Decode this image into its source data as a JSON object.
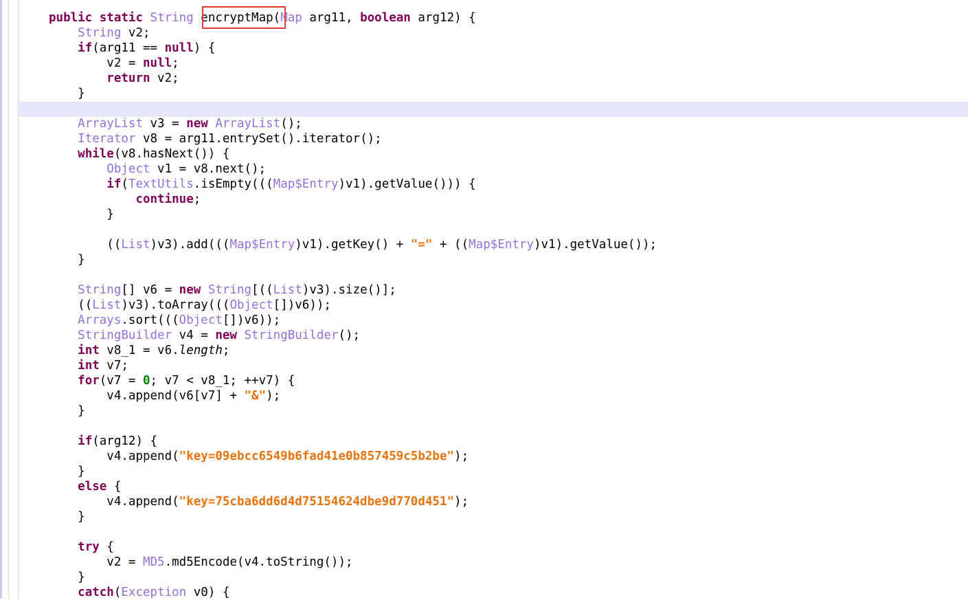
{
  "editor": {
    "lines": [
      {
        "indent": 0,
        "tokens": [
          [
            "kw",
            "public"
          ],
          [
            "p",
            " "
          ],
          [
            "kw",
            "static"
          ],
          [
            "p",
            " "
          ],
          [
            "ty",
            "String"
          ],
          [
            "p",
            " encryptMap("
          ],
          [
            "ty",
            "Map"
          ],
          [
            "p",
            " arg11, "
          ],
          [
            "kw",
            "boolean"
          ],
          [
            "p",
            " arg12) {"
          ]
        ]
      },
      {
        "indent": 1,
        "tokens": [
          [
            "ty",
            "String"
          ],
          [
            "p",
            " v2;"
          ]
        ]
      },
      {
        "indent": 1,
        "tokens": [
          [
            "kw",
            "if"
          ],
          [
            "p",
            "(arg11 == "
          ],
          [
            "kw",
            "null"
          ],
          [
            "p",
            ") {"
          ]
        ]
      },
      {
        "indent": 2,
        "tokens": [
          [
            "p",
            "v2 = "
          ],
          [
            "kw",
            "null"
          ],
          [
            "p",
            ";"
          ]
        ]
      },
      {
        "indent": 2,
        "tokens": [
          [
            "kw",
            "return"
          ],
          [
            "p",
            " v2;"
          ]
        ]
      },
      {
        "indent": 1,
        "tokens": [
          [
            "p",
            "}"
          ]
        ]
      },
      {
        "indent": 0,
        "tokens": []
      },
      {
        "indent": 1,
        "tokens": [
          [
            "ty",
            "ArrayList"
          ],
          [
            "p",
            " v3 = "
          ],
          [
            "kw",
            "new"
          ],
          [
            "p",
            " "
          ],
          [
            "ty",
            "ArrayList"
          ],
          [
            "p",
            "();"
          ]
        ]
      },
      {
        "indent": 1,
        "tokens": [
          [
            "ty",
            "Iterator"
          ],
          [
            "p",
            " v8 = arg11.entrySet().iterator();"
          ]
        ]
      },
      {
        "indent": 1,
        "tokens": [
          [
            "kw",
            "while"
          ],
          [
            "p",
            "(v8.hasNext()) {"
          ]
        ]
      },
      {
        "indent": 2,
        "tokens": [
          [
            "ty",
            "Object"
          ],
          [
            "p",
            " v1 = v8.next();"
          ]
        ]
      },
      {
        "indent": 2,
        "tokens": [
          [
            "kw",
            "if"
          ],
          [
            "p",
            "("
          ],
          [
            "ty",
            "TextUtils"
          ],
          [
            "p",
            ".isEmpty((("
          ],
          [
            "ty",
            "Map$Entry"
          ],
          [
            "p",
            ")v1).getValue())) {"
          ]
        ]
      },
      {
        "indent": 3,
        "tokens": [
          [
            "kw",
            "continue"
          ],
          [
            "p",
            ";"
          ]
        ]
      },
      {
        "indent": 2,
        "tokens": [
          [
            "p",
            "}"
          ]
        ]
      },
      {
        "indent": 0,
        "tokens": []
      },
      {
        "indent": 2,
        "tokens": [
          [
            "p",
            "(("
          ],
          [
            "ty",
            "List"
          ],
          [
            "p",
            ")v3).add((("
          ],
          [
            "ty",
            "Map$Entry"
          ],
          [
            "p",
            ")v1).getKey() + "
          ],
          [
            "str",
            "\"=\""
          ],
          [
            "p",
            " + (("
          ],
          [
            "ty",
            "Map$Entry"
          ],
          [
            "p",
            ")v1).getValue());"
          ]
        ]
      },
      {
        "indent": 1,
        "tokens": [
          [
            "p",
            "}"
          ]
        ]
      },
      {
        "indent": 0,
        "tokens": []
      },
      {
        "indent": 1,
        "tokens": [
          [
            "ty",
            "String"
          ],
          [
            "p",
            "[] v6 = "
          ],
          [
            "kw",
            "new"
          ],
          [
            "p",
            " "
          ],
          [
            "ty",
            "String"
          ],
          [
            "p",
            "[(("
          ],
          [
            "ty",
            "List"
          ],
          [
            "p",
            ")v3).size()];"
          ]
        ]
      },
      {
        "indent": 1,
        "tokens": [
          [
            "p",
            "(("
          ],
          [
            "ty",
            "List"
          ],
          [
            "p",
            ")v3).toArray((("
          ],
          [
            "ty",
            "Object"
          ],
          [
            "p",
            "[])v6));"
          ]
        ]
      },
      {
        "indent": 1,
        "tokens": [
          [
            "ty",
            "Arrays"
          ],
          [
            "p",
            ".sort((("
          ],
          [
            "ty",
            "Object"
          ],
          [
            "p",
            "[])v6));"
          ]
        ]
      },
      {
        "indent": 1,
        "tokens": [
          [
            "ty",
            "StringBuilder"
          ],
          [
            "p",
            " v4 = "
          ],
          [
            "kw",
            "new"
          ],
          [
            "p",
            " "
          ],
          [
            "ty",
            "StringBuilder"
          ],
          [
            "p",
            "();"
          ]
        ]
      },
      {
        "indent": 1,
        "tokens": [
          [
            "kw",
            "int"
          ],
          [
            "p",
            " v8_1 = v6."
          ],
          [
            "it",
            "length"
          ],
          [
            "p",
            ";"
          ]
        ]
      },
      {
        "indent": 1,
        "tokens": [
          [
            "kw",
            "int"
          ],
          [
            "p",
            " v7;"
          ]
        ]
      },
      {
        "indent": 1,
        "tokens": [
          [
            "kw",
            "for"
          ],
          [
            "p",
            "(v7 = "
          ],
          [
            "num",
            "0"
          ],
          [
            "p",
            "; v7 < v8_1; ++v7) {"
          ]
        ]
      },
      {
        "indent": 2,
        "tokens": [
          [
            "p",
            "v4.append(v6[v7] + "
          ],
          [
            "str",
            "\"&\""
          ],
          [
            "p",
            ");"
          ]
        ]
      },
      {
        "indent": 1,
        "tokens": [
          [
            "p",
            "}"
          ]
        ]
      },
      {
        "indent": 0,
        "tokens": []
      },
      {
        "indent": 1,
        "tokens": [
          [
            "kw",
            "if"
          ],
          [
            "p",
            "(arg12) {"
          ]
        ]
      },
      {
        "indent": 2,
        "tokens": [
          [
            "p",
            "v4.append("
          ],
          [
            "str",
            "\"key=09ebcc6549b6fad41e0b857459c5b2be\""
          ],
          [
            "p",
            ");"
          ]
        ]
      },
      {
        "indent": 1,
        "tokens": [
          [
            "p",
            "}"
          ]
        ]
      },
      {
        "indent": 1,
        "tokens": [
          [
            "kw",
            "else"
          ],
          [
            "p",
            " {"
          ]
        ]
      },
      {
        "indent": 2,
        "tokens": [
          [
            "p",
            "v4.append("
          ],
          [
            "str",
            "\"key=75cba6dd6d4d75154624dbe9d770d451\""
          ],
          [
            "p",
            ");"
          ]
        ]
      },
      {
        "indent": 1,
        "tokens": [
          [
            "p",
            "}"
          ]
        ]
      },
      {
        "indent": 0,
        "tokens": []
      },
      {
        "indent": 1,
        "tokens": [
          [
            "kw",
            "try"
          ],
          [
            "p",
            " {"
          ]
        ]
      },
      {
        "indent": 2,
        "tokens": [
          [
            "p",
            "v2 = "
          ],
          [
            "ty",
            "MD5"
          ],
          [
            "p",
            ".md5Encode(v4.toString());"
          ]
        ]
      },
      {
        "indent": 1,
        "tokens": [
          [
            "p",
            "}"
          ]
        ]
      },
      {
        "indent": 1,
        "tokens": [
          [
            "kw",
            "catch"
          ],
          [
            "p",
            "("
          ],
          [
            "ty",
            "Exception"
          ],
          [
            "p",
            " v0) {"
          ]
        ]
      }
    ]
  }
}
